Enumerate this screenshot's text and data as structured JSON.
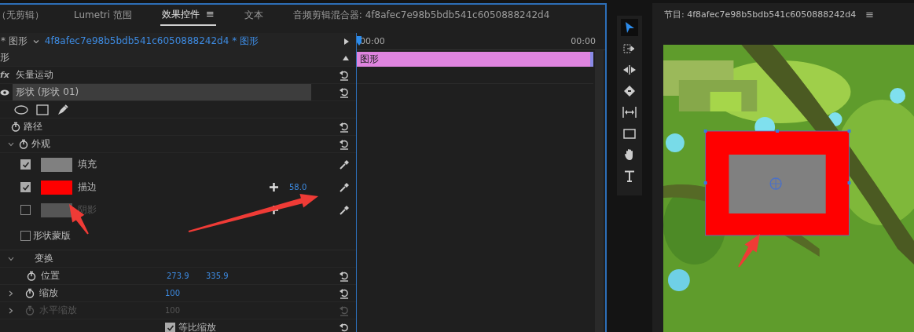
{
  "tabs": [
    {
      "label": "（无剪辑）",
      "selected": false
    },
    {
      "label": "Lumetri 范围",
      "selected": false
    },
    {
      "label": "效果控件",
      "selected": true,
      "menu": "≡"
    },
    {
      "label": "文本",
      "selected": false
    },
    {
      "label": "音频剪辑混合器: 4f8afec7e98b5bdb541c6050888242d4",
      "selected": false
    }
  ],
  "clip_header": {
    "master": "* 图形",
    "clip": "4f8afec7e98b5bdb541c6050888242d4 * 图形"
  },
  "effects": [
    {
      "kind": "section",
      "label": "形"
    },
    {
      "kind": "effect",
      "fx": "fx",
      "label": "矢量运动",
      "reset": true
    },
    {
      "kind": "layer",
      "label": "形状 (形状 01)",
      "reset": true
    },
    {
      "kind": "shape_tools"
    },
    {
      "kind": "property",
      "label": "路径",
      "reset": true
    },
    {
      "kind": "group",
      "label": "外观",
      "stopwatch": true,
      "expanded": true,
      "reset": true,
      "children": [
        {
          "kind": "appearance",
          "label": "填充",
          "checked": true,
          "color": "#808080",
          "disabled": false
        },
        {
          "kind": "appearance",
          "label": "描边",
          "checked": true,
          "color": "#ff0000",
          "disabled": false,
          "plus": true,
          "value": "58.0"
        },
        {
          "kind": "appearance",
          "label": "阴影",
          "checked": false,
          "color": "#555555",
          "disabled": true,
          "plus": true
        }
      ]
    },
    {
      "kind": "checkbox",
      "label": "形状蒙版",
      "checked": false
    },
    {
      "kind": "group",
      "label": "变换",
      "expanded": true,
      "children": [
        {
          "kind": "property",
          "label": "位置",
          "values": [
            "273.9",
            "335.9"
          ],
          "reset": true,
          "disabled": false
        },
        {
          "kind": "property",
          "label": "缩放",
          "values": [
            "100"
          ],
          "expanded": false,
          "reset": true,
          "disabled": false
        },
        {
          "kind": "property",
          "label": "水平缩放",
          "values": [
            "100"
          ],
          "expanded": false,
          "reset": true,
          "disabled": true
        },
        {
          "kind": "option",
          "label": "等比缩放",
          "checked": true,
          "reset": true
        }
      ]
    }
  ],
  "timeline": {
    "start": "00:00",
    "end": "00:00",
    "clip": "图形"
  },
  "tools": [
    {
      "kind": "select",
      "selected": true
    },
    {
      "kind": "track_select",
      "selected": false
    },
    {
      "kind": "ripple",
      "selected": false
    },
    {
      "kind": "razor",
      "selected": false
    },
    {
      "kind": "slip",
      "selected": false
    },
    {
      "kind": "rectangle",
      "selected": false
    },
    {
      "kind": "hand",
      "selected": false
    },
    {
      "kind": "type",
      "selected": false
    }
  ],
  "program": {
    "title": "节目: 4f8afec7e98b5bdb541c6050888242d4",
    "menu": "≡"
  }
}
